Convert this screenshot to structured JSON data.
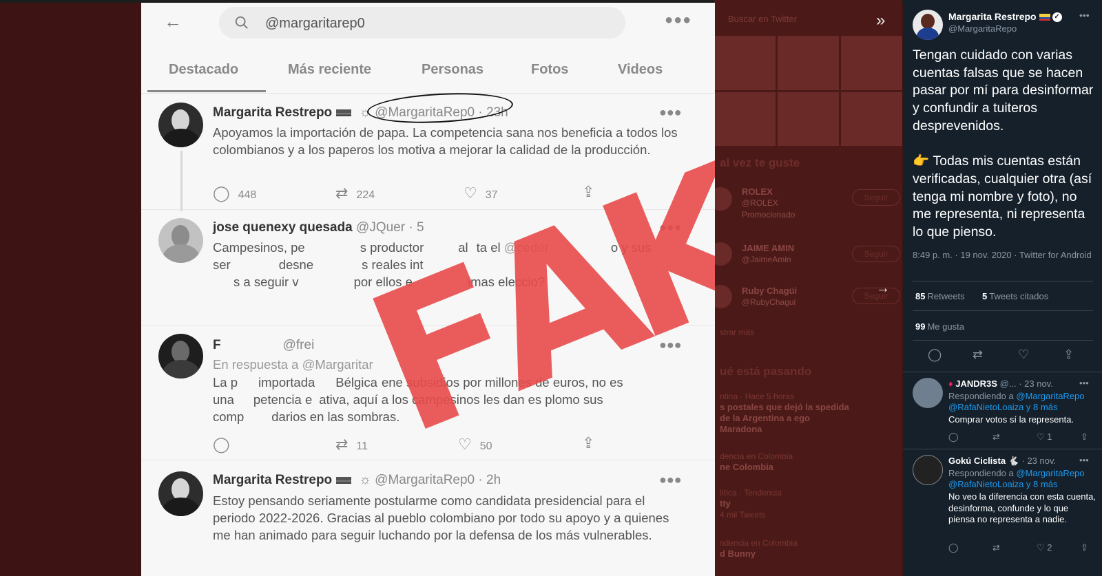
{
  "left": {
    "search_query": "@margaritarep0",
    "tabs": [
      "Destacado",
      "Más reciente",
      "Personas",
      "Fotos",
      "Videos"
    ],
    "tweets": [
      {
        "name": "Margarita Restrepo",
        "handle": "@MargaritaRep0 · 23h",
        "body": "Apoyamos la importación de papa. La competencia sana nos beneficia a todos los colombianos y a los paperos los motiva a mejorar la calidad de la producción.",
        "replies": "448",
        "retweets": "224",
        "likes": "37"
      },
      {
        "name": "jose quenexy quesada",
        "handle": "@JQuer",
        "handle_tail": "· 5",
        "body_lines": [
          "Campesinos, pe",
          "s productor",
          "al",
          "ta el",
          "@ceder",
          "o y sus",
          "ser",
          "desne",
          "s reales int",
          "s a seguir v",
          "por ellos e",
          "imas eleccio",
          "?"
        ]
      },
      {
        "name": "F",
        "handle": "@frei",
        "reply_to": "En respuesta a @Margaritar",
        "body_parts": [
          "La p",
          "importada",
          "Bélgica",
          "ene subsidios por millones de euros, no es",
          "una",
          "petencia e",
          "ativa, aquí a los campesinos les dan es plomo sus",
          "comp",
          "darios en las sombras."
        ],
        "retweets": "11",
        "likes": "50"
      },
      {
        "name": "Margarita Restrepo",
        "handle": "@MargaritaRep0 · 2h",
        "body": "Estoy pensando seriamente postularme como candidata presidencial para el periodo 2022-2026. Gracias al pueblo colombiano por todo su apoyo y a quienes me han animado para seguir luchando por la defensa de los más vulnerables."
      }
    ],
    "stamp_text": "FAKE",
    "stamp_color": "#e84a4a"
  },
  "background": {
    "search_placeholder": "Buscar en Twitter",
    "heading_suggest": "al vez te guste",
    "accounts": [
      {
        "name": "ROLEX",
        "handle": "@ROLEX",
        "sub": "Promocionado",
        "follow": "Seguir"
      },
      {
        "name": "JAIME AMIN",
        "handle": "@JaimeAmin",
        "follow": "Seguir"
      },
      {
        "name": "Ruby Chagüi",
        "handle": "@RubyChagui",
        "follow": "Seguir"
      }
    ],
    "show_more": "strar más",
    "heading_trends": "ué está pasando",
    "trends": [
      {
        "meta": "ntina · Hace 5 horas",
        "title": "s postales que dejó la spedida de la Argentina a ego Maradona"
      },
      {
        "meta": "dencia en Colombia",
        "title": "ne Colombia"
      },
      {
        "meta": "lítica · Tendencia",
        "title": "tty",
        "count": "4 mil Tweets"
      },
      {
        "meta": "ndencia en Colombia",
        "title": "d Bunny"
      }
    ]
  },
  "right": {
    "name": "Margarita Restrepo",
    "handle": "@MargaritaRepo",
    "text": "Tengan cuidado con varias cuentas falsas que se hacen pasar por mí para desinformar y confundir a tuiteros desprevenidos.\n\n👉 Todas mis cuentas están verificadas, cualquier otra (así tenga mi nombre y foto), no me representa, ni representa lo que pienso.",
    "timestamp": "8:49 p. m. · 19 nov. 2020 · Twitter for Android",
    "retweets_count": "85",
    "retweets_label": "Retweets",
    "quotes_count": "5",
    "quotes_label": "Tweets citados",
    "likes_count": "99",
    "likes_label": "Me gusta",
    "replies": [
      {
        "name": "JANDR3S",
        "meta": "@... · 23 nov.",
        "to_prefix": "Respondiendo a",
        "to_main": "@MargaritaRepo",
        "to_rest": "@RafaNietoLoaiza y 8 más",
        "text": "Comprar votos sí la representa.",
        "retweets": "1"
      },
      {
        "name": "Gokú Ciclista",
        "meta": "· 23 nov.",
        "to_prefix": "Respondiendo a",
        "to_main": "@MargaritaRepo",
        "to_rest": "@RafaNietoLoaiza y 8 más",
        "text": "No veo la diferencia con esta cuenta, desinforma, confunde y lo que piensa no representa a nadie.",
        "likes": "2"
      }
    ]
  }
}
